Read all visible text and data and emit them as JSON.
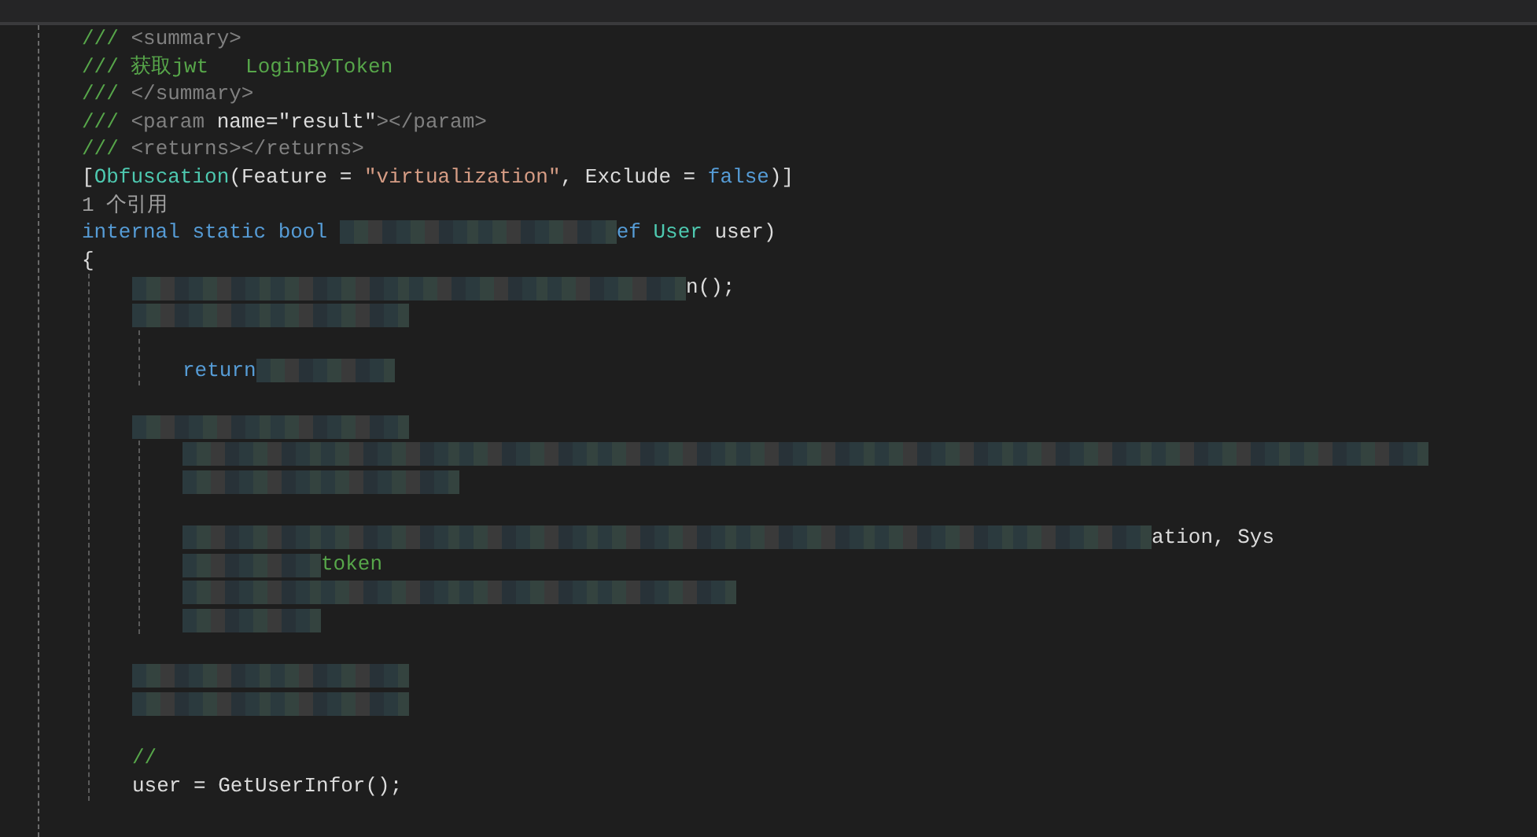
{
  "editor": {
    "lines": [
      {
        "segments": [
          {
            "kind": "comment",
            "text": "/// "
          },
          {
            "kind": "tag",
            "text": "<summary>"
          }
        ]
      },
      {
        "segments": [
          {
            "kind": "comment",
            "text": "/// 获取jwt   LoginByToken"
          }
        ]
      },
      {
        "segments": [
          {
            "kind": "comment",
            "text": "/// "
          },
          {
            "kind": "tag",
            "text": "</summary>"
          }
        ]
      },
      {
        "segments": [
          {
            "kind": "comment",
            "text": "/// "
          },
          {
            "kind": "tag",
            "text": "<param"
          },
          {
            "kind": "plain",
            "text": " name=\"result\""
          },
          {
            "kind": "tag",
            "text": "></param>"
          }
        ]
      },
      {
        "segments": [
          {
            "kind": "comment",
            "text": "/// "
          },
          {
            "kind": "tag",
            "text": "<returns></returns>"
          }
        ]
      },
      {
        "segments": [
          {
            "kind": "plain",
            "text": "["
          },
          {
            "kind": "type",
            "text": "Obfuscation"
          },
          {
            "kind": "plain",
            "text": "(Feature = "
          },
          {
            "kind": "string",
            "text": "\"virtualization\""
          },
          {
            "kind": "plain",
            "text": ", Exclude = "
          },
          {
            "kind": "keyword",
            "text": "false"
          },
          {
            "kind": "plain",
            "text": ")]"
          }
        ]
      },
      {
        "segments": [
          {
            "kind": "codelens",
            "text": "1 个引用"
          }
        ]
      },
      {
        "segments": [
          {
            "kind": "keyword",
            "text": "internal static bool "
          },
          {
            "kind": "redacted"
          },
          {
            "kind": "redacted"
          },
          {
            "kind": "keyword",
            "text": "ef "
          },
          {
            "kind": "type",
            "text": "User"
          },
          {
            "kind": "plain",
            "text": " user)"
          }
        ]
      },
      {
        "segments": [
          {
            "kind": "plain",
            "text": "{"
          }
        ],
        "children": [
          {
            "segments": [
              {
                "kind": "redacted"
              },
              {
                "kind": "redacted"
              },
              {
                "kind": "redacted"
              },
              {
                "kind": "redacted"
              },
              {
                "kind": "plain",
                "text": "n();"
              }
            ]
          },
          {
            "segments": [
              {
                "kind": "redacted"
              },
              {
                "kind": "redacted"
              }
            ],
            "children": [
              {
                "space_before": true,
                "segments": [
                  {
                    "kind": "keyword",
                    "text": "return"
                  },
                  {
                    "kind": "redacted"
                  }
                ]
              }
            ]
          },
          {
            "space_before": true,
            "segments": [
              {
                "kind": "redacted"
              },
              {
                "kind": "redacted"
              }
            ],
            "children": [
              {
                "segments": [
                  {
                    "kind": "redacted"
                  },
                  {
                    "kind": "redacted"
                  },
                  {
                    "kind": "redacted"
                  },
                  {
                    "kind": "redacted"
                  },
                  {
                    "kind": "redacted"
                  },
                  {
                    "kind": "redacted"
                  },
                  {
                    "kind": "redacted"
                  },
                  {
                    "kind": "redacted"
                  },
                  {
                    "kind": "redacted"
                  }
                ]
              },
              {
                "segments": [
                  {
                    "kind": "redacted"
                  },
                  {
                    "kind": "redacted"
                  }
                ]
              },
              {
                "space_before": true,
                "segments": [
                  {
                    "kind": "redacted"
                  },
                  {
                    "kind": "redacted"
                  },
                  {
                    "kind": "redacted"
                  },
                  {
                    "kind": "redacted"
                  },
                  {
                    "kind": "redacted"
                  },
                  {
                    "kind": "redacted"
                  },
                  {
                    "kind": "redacted"
                  },
                  {
                    "kind": "plain",
                    "text": "ation, Sys"
                  }
                ]
              },
              {
                "segments": [
                  {
                    "kind": "redacted"
                  },
                  {
                    "kind": "comment",
                    "text": "token"
                  }
                ]
              },
              {
                "segments": [
                  {
                    "kind": "redacted"
                  },
                  {
                    "kind": "redacted"
                  },
                  {
                    "kind": "redacted"
                  },
                  {
                    "kind": "redacted"
                  }
                ]
              },
              {
                "segments": [
                  {
                    "kind": "redacted"
                  }
                ]
              }
            ]
          },
          {
            "space_before": true,
            "segments": [
              {
                "kind": "redacted"
              },
              {
                "kind": "redacted"
              }
            ]
          },
          {
            "segments": [
              {
                "kind": "redacted"
              },
              {
                "kind": "redacted"
              }
            ]
          },
          {
            "space_before": true,
            "segments": [
              {
                "kind": "comment",
                "text": "//"
              }
            ]
          },
          {
            "segments": [
              {
                "kind": "plain",
                "text": "user = "
              },
              {
                "kind": "plain",
                "text": "GetUserInfor();"
              }
            ]
          }
        ]
      }
    ]
  }
}
